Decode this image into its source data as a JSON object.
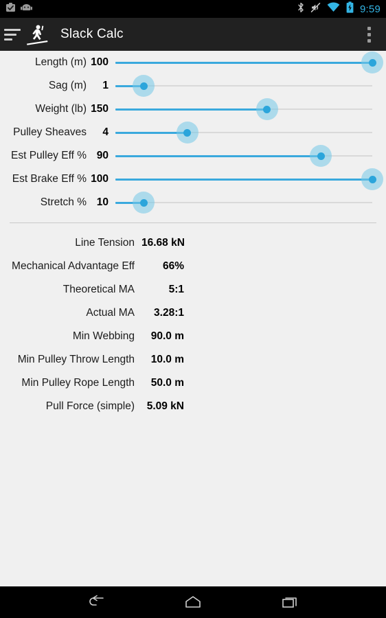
{
  "status_bar": {
    "notifications": [
      {
        "icon": "app-install-icon",
        "name": "app-install"
      },
      {
        "icon": "android-robot-icon",
        "name": "android-system"
      }
    ],
    "system_icons": [
      {
        "icon": "bluetooth-icon"
      },
      {
        "icon": "vibrate-muted-icon"
      },
      {
        "icon": "wifi-icon"
      },
      {
        "icon": "battery-charging-icon"
      }
    ],
    "clock": "9:59",
    "accent_color": "#33b5e5",
    "background_color": "#000000"
  },
  "app_bar": {
    "title": "Slack Calc",
    "logo_icon": "slackliner-icon",
    "drawer_icon": "drawer-lines-icon",
    "overflow_icon": "overflow-menu-icon",
    "background_color": "#212121",
    "title_color": "#ffffff"
  },
  "theme": {
    "content_background": "#f0f0f0",
    "slider_fill": "#3aa9dd",
    "slider_thumb_inner": "#2ba5db",
    "slider_thumb_halo": "#74c8e8",
    "slider_track": "#d9d9d9",
    "divider": "#c9c9c9"
  },
  "sliders": [
    {
      "label": "Length (m)",
      "value": "100",
      "percent": 100
    },
    {
      "label": "Sag (m)",
      "value": "1",
      "percent": 11
    },
    {
      "label": "Weight (lb)",
      "value": "150",
      "percent": 59
    },
    {
      "label": "Pulley Sheaves",
      "value": "4",
      "percent": 28
    },
    {
      "label": "Est Pulley Eff %",
      "value": "90",
      "percent": 80
    },
    {
      "label": "Est Brake Eff %",
      "value": "100",
      "percent": 100
    },
    {
      "label": "Stretch %",
      "value": "10",
      "percent": 11
    }
  ],
  "results": [
    {
      "label": "Line Tension",
      "value": "16.68 kN"
    },
    {
      "label": "Mechanical Advantage Eff",
      "value": "66%"
    },
    {
      "label": "Theoretical MA",
      "value": "5:1"
    },
    {
      "label": "Actual MA",
      "value": "3.28:1"
    },
    {
      "label": "Min Webbing",
      "value": "90.0 m"
    },
    {
      "label": "Min Pulley Throw Length",
      "value": "10.0 m"
    },
    {
      "label": "Min Pulley Rope Length",
      "value": "50.0 m"
    },
    {
      "label": "Pull Force (simple)",
      "value": "5.09 kN"
    }
  ],
  "nav_bar": {
    "buttons": [
      {
        "icon": "back-icon",
        "name": "nav-back"
      },
      {
        "icon": "home-icon",
        "name": "nav-home"
      },
      {
        "icon": "recents-icon",
        "name": "nav-recents"
      }
    ],
    "background_color": "#000000"
  }
}
